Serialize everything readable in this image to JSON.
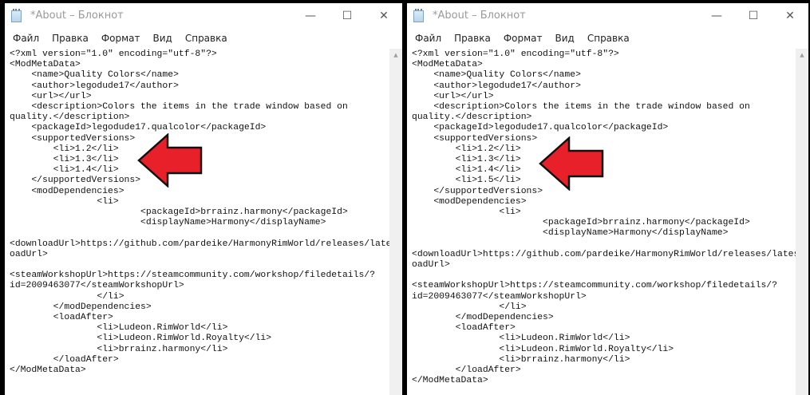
{
  "colors": {
    "arrow_fill": "#e8202a",
    "arrow_stroke": "#111111"
  },
  "left": {
    "title": "*About – Блокнот",
    "menu": [
      "Файл",
      "Правка",
      "Формат",
      "Вид",
      "Справка"
    ],
    "controls": {
      "minimize": "—",
      "maximize": "☐",
      "close": "✕"
    },
    "content": "<?xml version=\"1.0\" encoding=\"utf-8\"?>\n<ModMetaData>\n    <name>Quality Colors</name>\n    <author>legodude17</author>\n    <url></url>\n    <description>Colors the items in the trade window based on\nquality.</description>\n    <packageId>legodude17.qualcolor</packageId>\n    <supportedVersions>\n        <li>1.2</li>\n        <li>1.3</li>\n        <li>1.4</li>\n    </supportedVersions>\n    <modDependencies>\n                <li>\n                        <packageId>brrainz.harmony</packageId>\n                        <displayName>Harmony</displayName>\n\n<downloadUrl>https://github.com/pardeike/HarmonyRimWorld/releases/latest</down\noadUrl>\n\n<steamWorkshopUrl>https://steamcommunity.com/workshop/filedetails/?\nid=2009463077</steamWorkshopUrl>\n                </li>\n        </modDependencies>\n        <loadAfter>\n                <li>Ludeon.RimWorld</li>\n                <li>Ludeon.RimWorld.Royalty</li>\n                <li>brrainz.harmony</li>\n        </loadAfter>\n</ModMetaData>"
  },
  "right": {
    "title": "*About – Блокнот",
    "menu": [
      "Файл",
      "Правка",
      "Формат",
      "Вид",
      "Справка"
    ],
    "controls": {
      "minimize": "—",
      "maximize": "☐",
      "close": "✕"
    },
    "content": "<?xml version=\"1.0\" encoding=\"utf-8\"?>\n<ModMetaData>\n    <name>Quality Colors</name>\n    <author>legodude17</author>\n    <url></url>\n    <description>Colors the items in the trade window based on\nquality.</description>\n    <packageId>legodude17.qualcolor</packageId>\n    <supportedVersions>\n        <li>1.2</li>\n        <li>1.3</li>\n        <li>1.4</li>\n        <li>1.5</li>\n    </supportedVersions>\n    <modDependencies>\n                <li>\n                        <packageId>brrainz.harmony</packageId>\n                        <displayName>Harmony</displayName>\n\n<downloadUrl>https://github.com/pardeike/HarmonyRimWorld/releases/latest</downl\noadUrl>\n\n<steamWorkshopUrl>https://steamcommunity.com/workshop/filedetails/?\nid=2009463077</steamWorkshopUrl>\n                </li>\n        </modDependencies>\n        <loadAfter>\n                <li>Ludeon.RimWorld</li>\n                <li>Ludeon.RimWorld.Royalty</li>\n                <li>brrainz.harmony</li>\n        </loadAfter>\n</ModMetaData>"
  }
}
